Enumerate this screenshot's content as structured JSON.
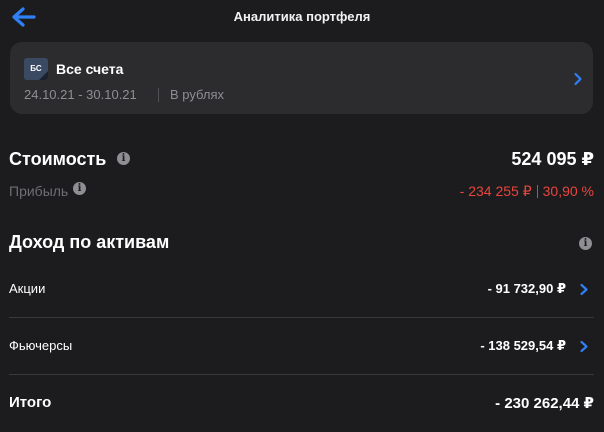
{
  "header": {
    "title": "Аналитика портфеля",
    "back_icon": "arrow-left-icon",
    "accent_color": "#2f7ff7"
  },
  "account": {
    "logo_text": "БС",
    "name": "Все счета",
    "period": "24.10.21 - 30.10.21",
    "currency": "В рублях",
    "chevron_icon": "chevron-right-icon"
  },
  "summary": {
    "value_title": "Стоимость",
    "value_amount": "524 095 ₽",
    "profit_label": "Прибыль",
    "profit_amount": "- 234 255 ₽",
    "profit_percent": "30,90 %",
    "negative_color": "#e8453c",
    "info_icon": "info-icon"
  },
  "income": {
    "title": "Доход по активам",
    "rows": [
      {
        "label": "Акции",
        "value": "- 91 732,90 ₽"
      },
      {
        "label": "Фьючерсы",
        "value": "- 138 529,54 ₽"
      }
    ],
    "total_label": "Итого",
    "total_value": "- 230 262,44 ₽"
  }
}
